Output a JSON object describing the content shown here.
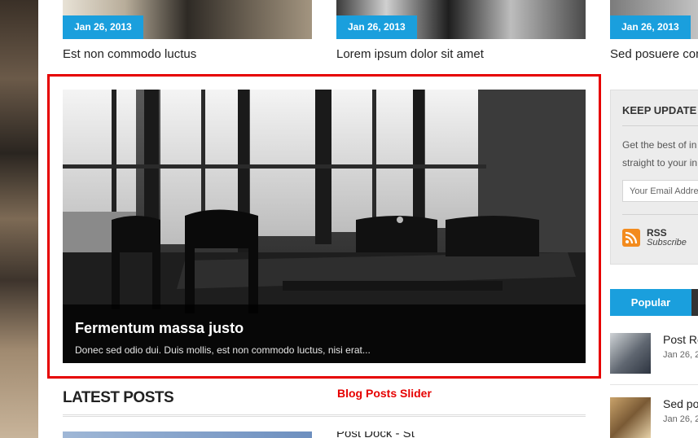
{
  "top_posts": [
    {
      "date": "Jan 26, 2013",
      "title": "Est non commodo luctus"
    },
    {
      "date": "Jan 26, 2013",
      "title": "Lorem ipsum dolor sit amet"
    },
    {
      "date": "Jan 26, 2013",
      "title": "Sed posuere con"
    }
  ],
  "slider": {
    "title": "Fermentum massa justo",
    "excerpt": "Donec sed odio dui. Duis mollis, est non commodo luctus, nisi erat...",
    "annotation": "Blog Posts Slider"
  },
  "latest": {
    "heading": "LATEST POSTS",
    "next_title": "Post Dock - St"
  },
  "sidebar": {
    "newsletter": {
      "title": "KEEP UPDATE W",
      "text_line1": "Get the best of in",
      "text_line2": "straight to your in",
      "email_placeholder": "Your Email Address"
    },
    "rss": {
      "label": "RSS",
      "sub": "Subscribe"
    },
    "tabs": {
      "popular": "Popular"
    },
    "posts": [
      {
        "title": "Post Re",
        "date": "Jan 26, 2"
      },
      {
        "title": "Sed pos",
        "date": "Jan 26, 2"
      }
    ]
  },
  "colors": {
    "accent": "#1a9fdd",
    "annotation": "#e60000",
    "rss": "#f38b1e"
  }
}
